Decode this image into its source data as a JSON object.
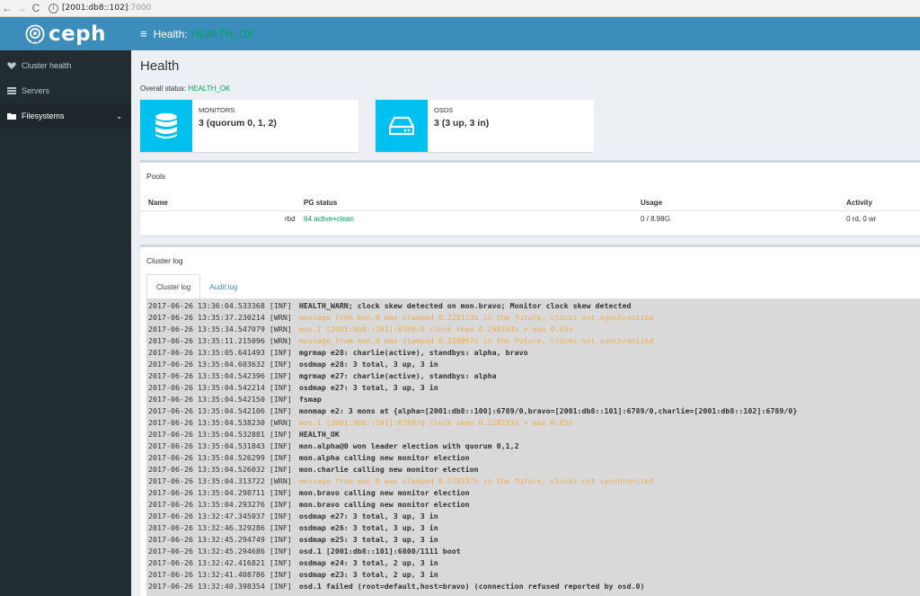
{
  "browser": {
    "back": "←",
    "forward": "→",
    "reload": "C",
    "info": "i",
    "url_host": "[2001:db8::102]",
    "url_port": ":7000"
  },
  "brand": {
    "name": "ceph"
  },
  "sidebar": {
    "items": [
      {
        "label": "Cluster health",
        "icon": "heart-icon"
      },
      {
        "label": "Servers",
        "icon": "server-list-icon"
      },
      {
        "label": "Filesystems",
        "icon": "folder-icon",
        "chevron": "⌄"
      }
    ]
  },
  "header": {
    "menu": "≡",
    "label": "Health:",
    "status": "HEALTH_OK",
    "status_color": "#00a65a"
  },
  "page": {
    "title": "Health",
    "overall_label": "Overall status:",
    "overall_value": "HEALTH_OK"
  },
  "monitors": {
    "label": "MONITORS",
    "value": "3 (quorum 0, 1, 2)",
    "icon": "database-icon"
  },
  "osds": {
    "label": "OSDS",
    "value": "3 (3 up, 3 in)",
    "icon": "hard-drive-icon"
  },
  "pools": {
    "title": "Pools",
    "columns": {
      "name": "Name",
      "pg": "PG status",
      "usage": "Usage",
      "activity": "Activity"
    },
    "rows": [
      {
        "name": "rbd",
        "pg": "64 active+clean",
        "usage": "0 / 8.98G",
        "activity": "0 rd, 0 wr"
      }
    ]
  },
  "cluster_log": {
    "title": "Cluster log",
    "tabs": [
      "Cluster log",
      "Audit log"
    ],
    "lines": [
      {
        "ts": "2017-06-26 13:36:04.533368 [INF]",
        "msg": "HEALTH_WARN; clock skew detected on mon.bravo; Monitor clock skew detected",
        "warn": false
      },
      {
        "ts": "2017-06-26 13:35:37.230214 [WRN]",
        "msg": "message from mon.0 was stamped 0.228123s in the future, clocks not synchronized",
        "warn": true
      },
      {
        "ts": "2017-06-26 13:35:34.547079 [WRN]",
        "msg": "mon.1 [2001:db8::101]:6789/0 clock skew 0.230164s > max 0.05s",
        "warn": true
      },
      {
        "ts": "2017-06-26 13:35:11.215096 [WRN]",
        "msg": "message from mon.0 was stamped 0.228957s in the future, clocks not synchronized",
        "warn": true
      },
      {
        "ts": "2017-06-26 13:35:05.641493 [INF]",
        "msg": "mgrmap e28: charlie(active), standbys: alpha, bravo",
        "warn": false
      },
      {
        "ts": "2017-06-26 13:35:04.603632 [INF]",
        "msg": "osdmap e28: 3 total, 3 up, 3 in",
        "warn": false
      },
      {
        "ts": "2017-06-26 13:35:04.542396 [INF]",
        "msg": "mgrmap e27: charlie(active), standbys: alpha",
        "warn": false
      },
      {
        "ts": "2017-06-26 13:35:04.542214 [INF]",
        "msg": "osdmap e27: 3 total, 3 up, 3 in",
        "warn": false
      },
      {
        "ts": "2017-06-26 13:35:04.542150 [INF]",
        "msg": "fsmap",
        "warn": false
      },
      {
        "ts": "2017-06-26 13:35:04.542106 [INF]",
        "msg": "monmap e2: 3 mons at {alpha=[2001:db8::100]:6789/0,bravo=[2001:db8::101]:6789/0,charlie=[2001:db8::102]:6789/0}",
        "warn": false
      },
      {
        "ts": "2017-06-26 13:35:04.538230 [WRN]",
        "msg": "mon.1 [2001:db8::101]:6789/0 clock skew 0.228233s > max 0.05s",
        "warn": true
      },
      {
        "ts": "2017-06-26 13:35:04.532881 [INF]",
        "msg": "HEALTH_OK",
        "warn": false
      },
      {
        "ts": "2017-06-26 13:35:04.531843 [INF]",
        "msg": "mon.alpha@0 won leader election with quorum 0,1,2",
        "warn": false
      },
      {
        "ts": "2017-06-26 13:35:04.526299 [INF]",
        "msg": "mon.alpha calling new monitor election",
        "warn": false
      },
      {
        "ts": "2017-06-26 13:35:04.526032 [INF]",
        "msg": "mon.charlie calling new monitor election",
        "warn": false
      },
      {
        "ts": "2017-06-26 13:35:04.313722 [WRN]",
        "msg": "message from mon.0 was stamped 0.228197s in the future, clocks not synchronized",
        "warn": true
      },
      {
        "ts": "2017-06-26 13:35:04.298711 [INF]",
        "msg": "mon.bravo calling new monitor election",
        "warn": false
      },
      {
        "ts": "2017-06-26 13:35:04.293276 [INF]",
        "msg": "mon.bravo calling new monitor election",
        "warn": false
      },
      {
        "ts": "2017-06-26 13:32:47.345037 [INF]",
        "msg": "osdmap e27: 3 total, 3 up, 3 in",
        "warn": false
      },
      {
        "ts": "2017-06-26 13:32:46.329286 [INF]",
        "msg": "osdmap e26: 3 total, 3 up, 3 in",
        "warn": false
      },
      {
        "ts": "2017-06-26 13:32:45.294749 [INF]",
        "msg": "osdmap e25: 3 total, 3 up, 3 in",
        "warn": false
      },
      {
        "ts": "2017-06-26 13:32:45.294686 [INF]",
        "msg": "osd.1 [2001:db8::101]:6800/1111 boot",
        "warn": false
      },
      {
        "ts": "2017-06-26 13:32:42.416821 [INF]",
        "msg": "osdmap e24: 3 total, 2 up, 3 in",
        "warn": false
      },
      {
        "ts": "2017-06-26 13:32:41.408786 [INF]",
        "msg": "osdmap e23: 3 total, 2 up, 3 in",
        "warn": false
      },
      {
        "ts": "2017-06-26 13:32:40.398354 [INF]",
        "msg": "osd.1 failed (root=default,host=bravo) (connection refused reported by osd.0)",
        "warn": false
      }
    ]
  }
}
